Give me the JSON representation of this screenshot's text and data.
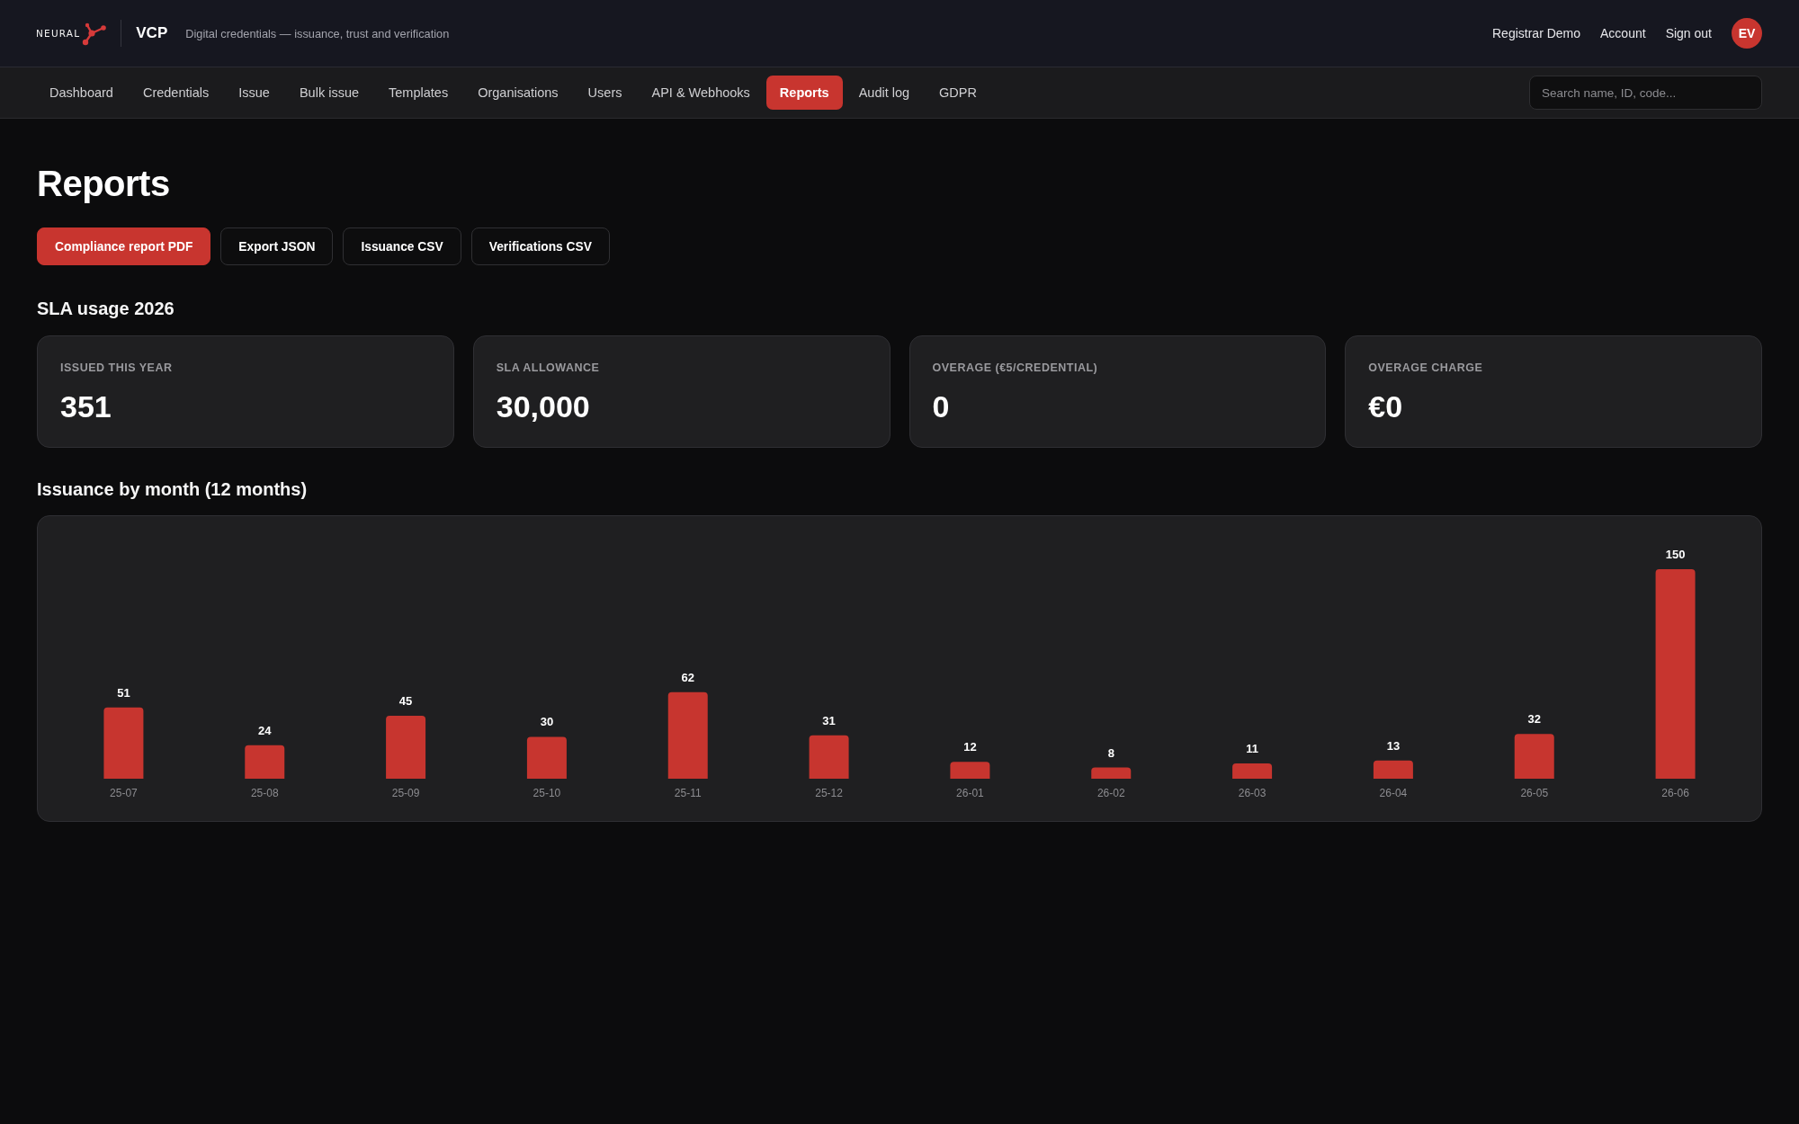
{
  "header": {
    "logo": "NEURAL",
    "app_name": "VCP",
    "tagline": "Digital credentials — issuance, trust and verification",
    "links": [
      "Registrar Demo",
      "Account",
      "Sign out"
    ],
    "avatar": "EV"
  },
  "nav": {
    "tabs": [
      {
        "label": "Dashboard",
        "selected": false
      },
      {
        "label": "Credentials",
        "selected": false
      },
      {
        "label": "Issue",
        "selected": false
      },
      {
        "label": "Bulk issue",
        "selected": false
      },
      {
        "label": "Templates",
        "selected": false
      },
      {
        "label": "Organisations",
        "selected": false
      },
      {
        "label": "Users",
        "selected": false
      },
      {
        "label": "API & Webhooks",
        "selected": false
      },
      {
        "label": "Reports",
        "selected": true
      },
      {
        "label": "Audit log",
        "selected": false
      },
      {
        "label": "GDPR",
        "selected": false
      }
    ],
    "search": {
      "placeholder": "Search name, ID, code..."
    }
  },
  "page": {
    "title": "Reports",
    "actions": [
      {
        "label": "Compliance report PDF",
        "kind": "primary"
      },
      {
        "label": "Export JSON",
        "kind": "secondary"
      },
      {
        "label": "Issuance CSV",
        "kind": "secondary"
      },
      {
        "label": "Verifications CSV",
        "kind": "secondary"
      }
    ]
  },
  "sla": {
    "title": "SLA usage 2026",
    "stats": [
      {
        "label": "ISSUED THIS YEAR",
        "value": "351"
      },
      {
        "label": "SLA ALLOWANCE",
        "value": "30,000"
      },
      {
        "label": "OVERAGE (€5/CREDENTIAL)",
        "value": "0"
      },
      {
        "label": "OVERAGE CHARGE",
        "value": "€0"
      }
    ]
  },
  "issuance": {
    "title": "Issuance by month (12 months)",
    "chart_data": {
      "type": "bar",
      "categories": [
        "25-07",
        "25-08",
        "25-09",
        "25-10",
        "25-11",
        "25-12",
        "26-01",
        "26-02",
        "26-03",
        "26-04",
        "26-05",
        "26-06"
      ],
      "values": [
        51,
        24,
        45,
        30,
        62,
        31,
        12,
        8,
        11,
        13,
        32,
        150
      ],
      "data_labels": true
    }
  }
}
